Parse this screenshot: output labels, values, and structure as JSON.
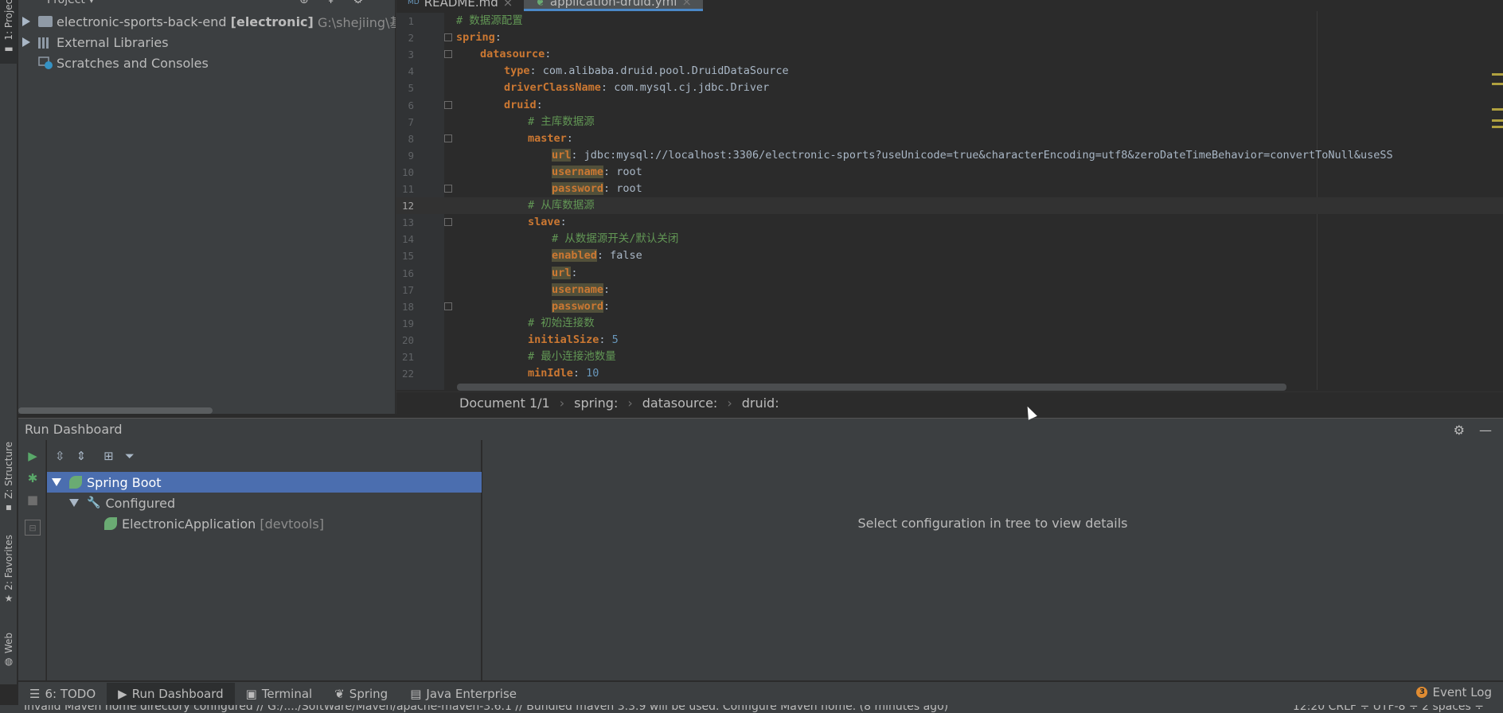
{
  "left_stripe": {
    "project_tab": "1: Project",
    "structure_tab": "Z: Structure",
    "favorites_tab": "2: Favorites",
    "web_tab": "Web"
  },
  "project": {
    "header": "Project",
    "items": [
      {
        "name": "electronic-sports-back-end",
        "module": "[electronic]",
        "path": "G:\\shejiing\\基于sp"
      },
      {
        "name": "External Libraries"
      },
      {
        "name": "Scratches and Consoles"
      }
    ]
  },
  "editor": {
    "tabs": [
      "README.md",
      "application-druid.yml"
    ],
    "breadcrumbs": [
      "Document 1/1",
      "spring:",
      "datasource:",
      "druid:"
    ],
    "lines": [
      {
        "n": "1",
        "comment": "# 数据源配置"
      },
      {
        "n": "2",
        "key": "spring",
        "value": ""
      },
      {
        "n": "3",
        "key": "datasource",
        "value": ""
      },
      {
        "n": "4",
        "key": "type",
        "value": " com.alibaba.druid.pool.DruidDataSource"
      },
      {
        "n": "5",
        "key": "driverClassName",
        "value": " com.mysql.cj.jdbc.Driver"
      },
      {
        "n": "6",
        "key": "druid",
        "value": ""
      },
      {
        "n": "7",
        "comment": "# 主库数据源"
      },
      {
        "n": "8",
        "key": "master",
        "value": ""
      },
      {
        "n": "9",
        "key": "url",
        "value": " jdbc:mysql://localhost:3306/electronic-sports?useUnicode=true&characterEncoding=utf8&zeroDateTimeBehavior=convertToNull&useSS"
      },
      {
        "n": "10",
        "key": "username",
        "value": " root"
      },
      {
        "n": "11",
        "key": "password",
        "value": " root"
      },
      {
        "n": "12",
        "comment": "# 从库数据源"
      },
      {
        "n": "13",
        "key": "slave",
        "value": ""
      },
      {
        "n": "14",
        "comment": "# 从数据源开关/默认关闭"
      },
      {
        "n": "15",
        "key": "enabled",
        "value": " false"
      },
      {
        "n": "16",
        "key": "url",
        "value": ""
      },
      {
        "n": "17",
        "key": "username",
        "value": ""
      },
      {
        "n": "18",
        "key": "password",
        "value": ""
      },
      {
        "n": "19",
        "comment": "# 初始连接数"
      },
      {
        "n": "20",
        "key": "initialSize",
        "value": " 5"
      },
      {
        "n": "21",
        "comment": "# 最小连接池数量"
      },
      {
        "n": "22",
        "key": "minIdle",
        "value": " 10"
      }
    ]
  },
  "run_dashboard": {
    "title": "Run Dashboard",
    "tree": {
      "root": "Spring Boot",
      "group": "Configured",
      "app_name": "ElectronicApplication",
      "app_tag": "[devtools]"
    },
    "detail_message": "Select configuration in tree to view details"
  },
  "bottom_bar": {
    "todo": "6: TODO",
    "run_dashboard": "Run Dashboard",
    "terminal": "Terminal",
    "spring": "Spring",
    "java_enterprise": "Java Enterprise",
    "event_log": "Event Log",
    "event_count": "3"
  },
  "status_bar": {
    "message": "Invalid Maven home directory configured // G:/..../SoftWare/Maven/apache-maven-3.6.1 // Bundled maven 3.3.9 will be used. Configure Maven home. (8 minutes ago)",
    "right": "12:20   CRLF ÷   UTF-8 ÷   2 spaces ÷"
  },
  "colors": {
    "keyword": "#cc7832",
    "comment": "#629755",
    "value": "#a9b7c6",
    "number": "#6897bb",
    "selection": "#4b6eaf",
    "highlight": "#52503a"
  }
}
